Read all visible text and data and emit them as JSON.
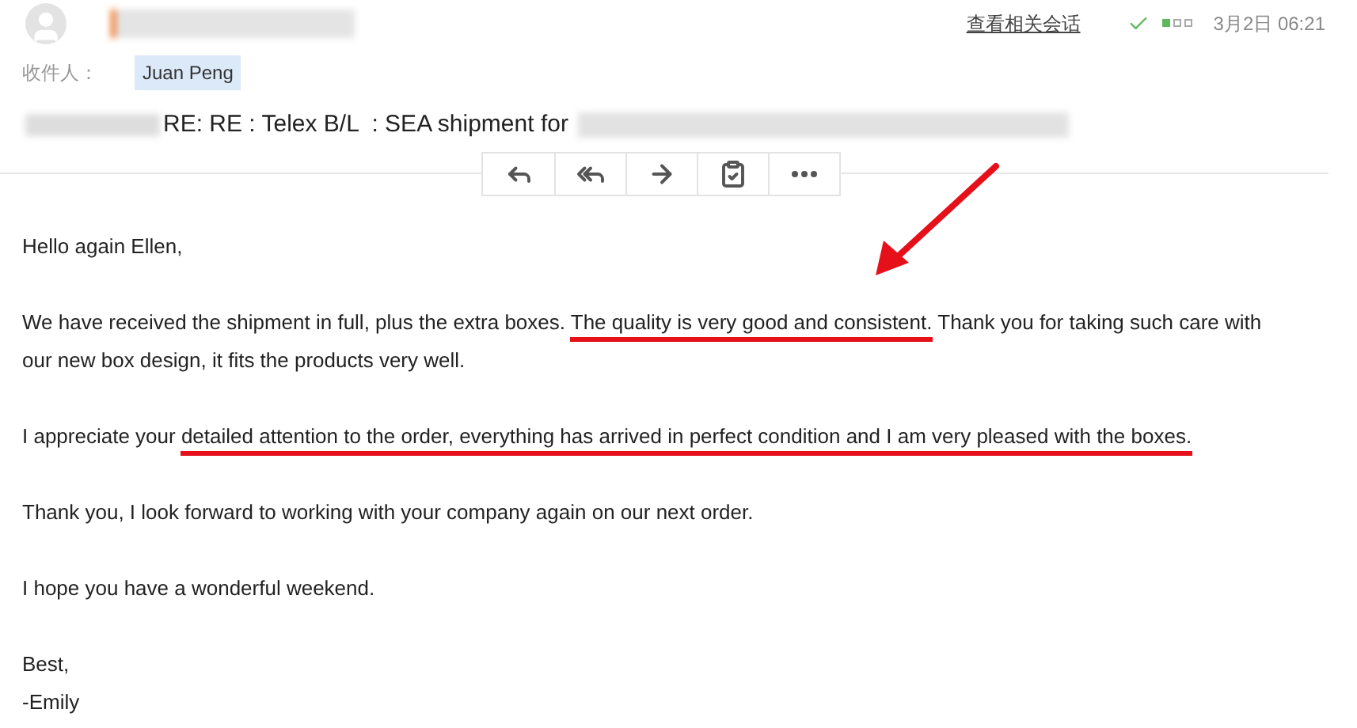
{
  "header": {
    "related_link": "查看相关会话",
    "date": "3月2日 06:21"
  },
  "recipient": {
    "label": "收件人：",
    "name": "Juan Peng"
  },
  "subject": "RE: RE : Telex B/L  : SEA shipment for",
  "body": [
    [
      {
        "text": "Hello again Ellen,",
        "marked": false
      }
    ],
    [
      {
        "text": "We have received the shipment in full, plus the extra boxes. ",
        "marked": false
      },
      {
        "text": "The quality is very good and consistent.",
        "marked": true
      },
      {
        "text": " Thank you for taking such care with our new box design, it fits the products very well.",
        "marked": false
      }
    ],
    [
      {
        "text": "I appreciate your ",
        "marked": false
      },
      {
        "text": "detailed attention to the order, everything has arrived in perfect condition and I am very pleased with the boxes.",
        "marked": true
      }
    ],
    [
      {
        "text": "Thank you, I look forward to working with your company again on our next order.",
        "marked": false
      }
    ],
    [
      {
        "text": "I hope you have a wonderful weekend.",
        "marked": false
      }
    ],
    [
      {
        "text": "Best,\n-Emily",
        "marked": false
      }
    ]
  ]
}
